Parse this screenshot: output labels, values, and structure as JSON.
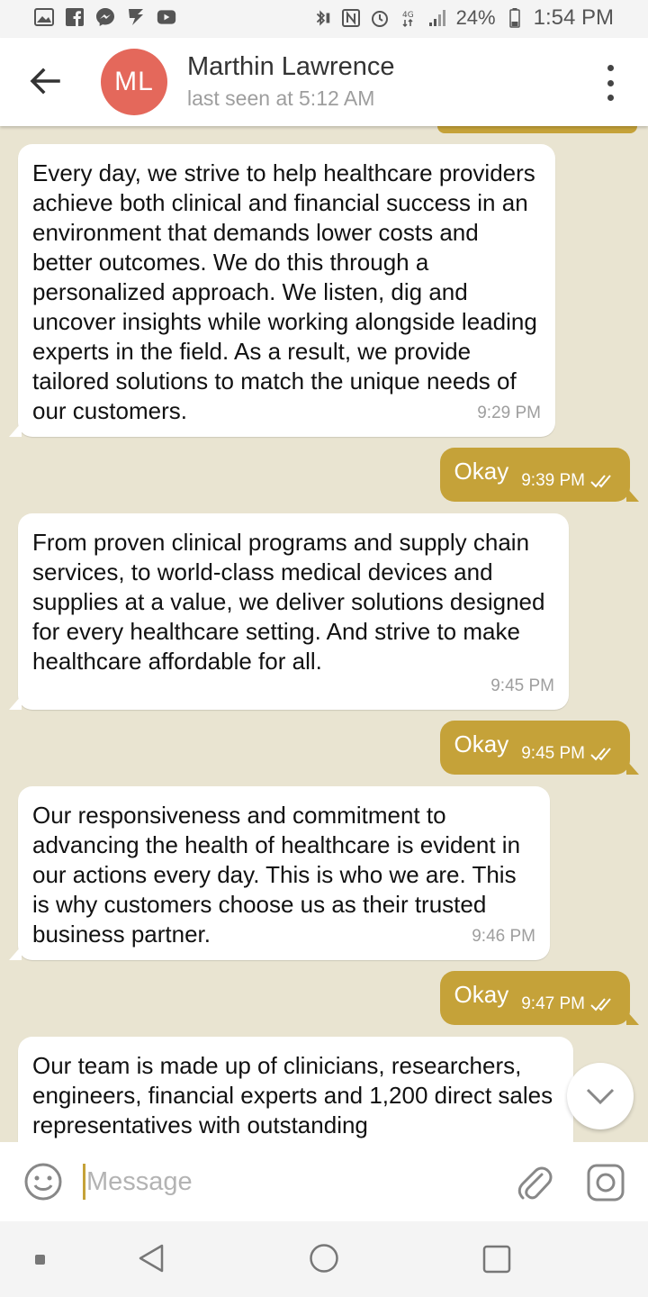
{
  "status_bar": {
    "time": "1:54 PM",
    "battery": "24%",
    "left_icons": [
      "gallery-icon",
      "facebook-icon",
      "messenger-icon",
      "flipboard-icon",
      "youtube-icon"
    ],
    "right_icons": [
      "bluetooth-icon",
      "nfc-icon",
      "alarm-icon",
      "4g-icon",
      "signal-icon",
      "battery-icon"
    ]
  },
  "header": {
    "avatar_initials": "ML",
    "avatar_color": "#e4685b",
    "contact_name": "Marthin Lawrence",
    "status": "last seen at 5:12 AM"
  },
  "colors": {
    "chat_background": "#e9e4d1",
    "outgoing_bubble": "#c5a239",
    "incoming_bubble": "#ffffff"
  },
  "messages": [
    {
      "direction": "in",
      "text": "Every day, we strive to help healthcare providers achieve both clinical and financial success in an environment that demands lower costs and better outcomes. We do this through a personalized approach. We listen, dig and uncover insights while working alongside leading experts in the field. As a result, we provide tailored solutions to match the unique needs of our customers.",
      "time": "9:29 PM"
    },
    {
      "direction": "out",
      "text": "Okay",
      "time": "9:39 PM",
      "read": true
    },
    {
      "direction": "in",
      "text": "From proven clinical programs and supply chain services, to world-class medical devices and supplies at a value, we deliver solutions designed for every healthcare setting. And strive to make healthcare affordable for all.",
      "time": "9:45 PM"
    },
    {
      "direction": "out",
      "text": "Okay",
      "time": "9:45 PM",
      "read": true
    },
    {
      "direction": "in",
      "text": "Our responsiveness and commitment to advancing the health of healthcare is evident in our actions every day. This is who we are. This is why customers choose us as their trusted business partner.",
      "time": "9:46 PM"
    },
    {
      "direction": "out",
      "text": "Okay",
      "time": "9:47 PM",
      "read": true
    },
    {
      "direction": "in",
      "text": "Our team is made up of clinicians, researchers, engineers, financial experts and 1,200 direct sales representatives with outstanding",
      "time": ""
    }
  ],
  "input": {
    "placeholder": "Message",
    "value": ""
  }
}
